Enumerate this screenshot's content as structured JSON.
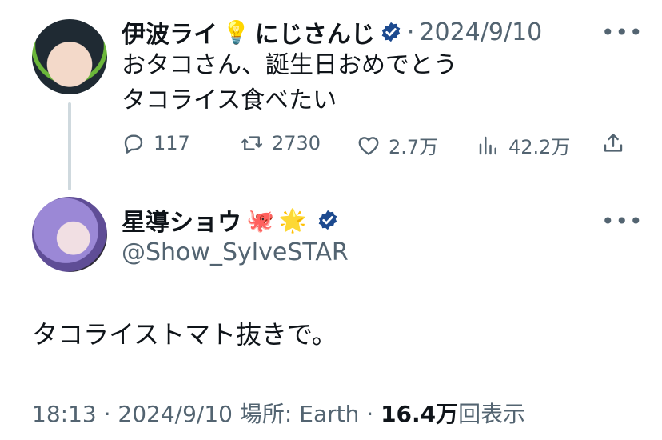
{
  "parent": {
    "name": "伊波ライ",
    "badge_emoji": "💡",
    "name_suffix": "にじさんじ",
    "separator": "·",
    "date": "2024/9/10",
    "text_line1": "おタコさん、誕生日おめでとう",
    "text_line2": "タコライス食べたい",
    "actions": {
      "replies": "117",
      "retweets": "2730",
      "likes": "2.7万",
      "views": "42.2万"
    }
  },
  "reply": {
    "name": "星導ショウ",
    "emoji1": "🐙",
    "emoji2": "🌟",
    "handle": "@Show_SylveSTAR",
    "text": "タコライストマト抜きで。"
  },
  "footer": {
    "time": "18:13",
    "sep1": "·",
    "date": "2024/9/10",
    "location_label": "場所:",
    "location": "Earth",
    "sep2": "·",
    "views_count": "16.4万",
    "views_label": "回表示"
  },
  "colors": {
    "text": "#0f1419",
    "muted": "#536471",
    "verified_blue": "#1d9bf0",
    "thread_line": "#cfd9de"
  },
  "icons": [
    "more-icon",
    "reply-icon",
    "retweet-icon",
    "like-icon",
    "views-icon",
    "share-icon",
    "verified-badge-icon"
  ]
}
